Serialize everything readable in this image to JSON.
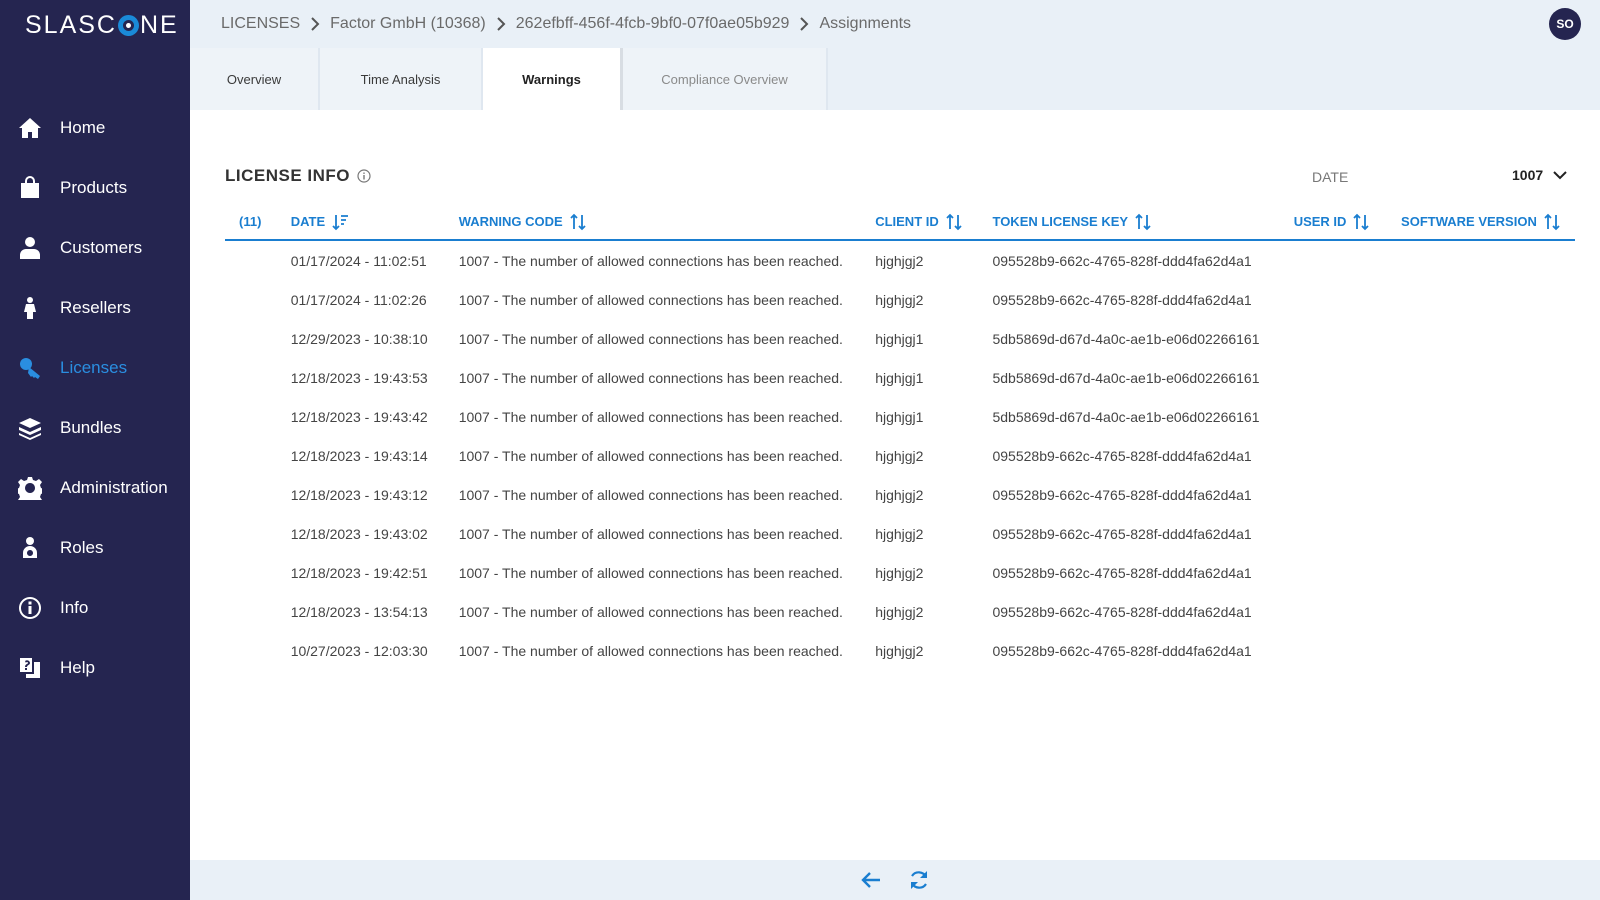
{
  "app": {
    "logo_text_left": "SLASC",
    "logo_text_right": "NE"
  },
  "colors": {
    "sidebar_bg": "#252550",
    "accent": "#1a7ed0",
    "topbar_bg": "#e9f0f7",
    "active_nav": "#2a8ee0"
  },
  "sidebar": {
    "items": [
      {
        "label": "Home",
        "icon": "home-icon"
      },
      {
        "label": "Products",
        "icon": "shopping-bag-icon"
      },
      {
        "label": "Customers",
        "icon": "user-icon"
      },
      {
        "label": "Resellers",
        "icon": "reseller-icon"
      },
      {
        "label": "Licenses",
        "icon": "key-icon",
        "active": true
      },
      {
        "label": "Bundles",
        "icon": "stack-icon"
      },
      {
        "label": "Administration",
        "icon": "gear-icon"
      },
      {
        "label": "Roles",
        "icon": "role-icon"
      },
      {
        "label": "Info",
        "icon": "info-icon"
      },
      {
        "label": "Help",
        "icon": "help-icon"
      }
    ]
  },
  "header": {
    "breadcrumb": [
      "LICENSES",
      "Factor GmbH (10368)",
      "262efbff-456f-4fcb-9bf0-07f0ae05b929",
      "Assignments"
    ],
    "avatar": "SO"
  },
  "tabs": [
    {
      "label": "Overview"
    },
    {
      "label": "Time Analysis"
    },
    {
      "label": "Warnings",
      "active": true
    },
    {
      "label": "Compliance Overview",
      "disabled": true
    }
  ],
  "main": {
    "section_title": "LICENSE INFO",
    "date_filter_label": "DATE",
    "date_filter_value": "1007"
  },
  "table": {
    "count": "(11)",
    "columns": [
      "DATE",
      "WARNING CODE",
      "CLIENT ID",
      "TOKEN LICENSE KEY",
      "USER ID",
      "SOFTWARE VERSION"
    ],
    "rows": [
      [
        "01/17/2024 - 11:02:51",
        "1007 - The number of allowed connections has been reached.",
        "hjghjgj2",
        "095528b9-662c-4765-828f-ddd4fa62d4a1",
        "",
        ""
      ],
      [
        "01/17/2024 - 11:02:26",
        "1007 - The number of allowed connections has been reached.",
        "hjghjgj2",
        "095528b9-662c-4765-828f-ddd4fa62d4a1",
        "",
        ""
      ],
      [
        "12/29/2023 - 10:38:10",
        "1007 - The number of allowed connections has been reached.",
        "hjghjgj1",
        "5db5869d-d67d-4a0c-ae1b-e06d02266161",
        "",
        ""
      ],
      [
        "12/18/2023 - 19:43:53",
        "1007 - The number of allowed connections has been reached.",
        "hjghjgj1",
        "5db5869d-d67d-4a0c-ae1b-e06d02266161",
        "",
        ""
      ],
      [
        "12/18/2023 - 19:43:42",
        "1007 - The number of allowed connections has been reached.",
        "hjghjgj1",
        "5db5869d-d67d-4a0c-ae1b-e06d02266161",
        "",
        ""
      ],
      [
        "12/18/2023 - 19:43:14",
        "1007 - The number of allowed connections has been reached.",
        "hjghjgj2",
        "095528b9-662c-4765-828f-ddd4fa62d4a1",
        "",
        ""
      ],
      [
        "12/18/2023 - 19:43:12",
        "1007 - The number of allowed connections has been reached.",
        "hjghjgj2",
        "095528b9-662c-4765-828f-ddd4fa62d4a1",
        "",
        ""
      ],
      [
        "12/18/2023 - 19:43:02",
        "1007 - The number of allowed connections has been reached.",
        "hjghjgj2",
        "095528b9-662c-4765-828f-ddd4fa62d4a1",
        "",
        ""
      ],
      [
        "12/18/2023 - 19:42:51",
        "1007 - The number of allowed connections has been reached.",
        "hjghjgj2",
        "095528b9-662c-4765-828f-ddd4fa62d4a1",
        "",
        ""
      ],
      [
        "12/18/2023 - 13:54:13",
        "1007 - The number of allowed connections has been reached.",
        "hjghjgj2",
        "095528b9-662c-4765-828f-ddd4fa62d4a1",
        "",
        ""
      ],
      [
        "10/27/2023 - 12:03:30",
        "1007 - The number of allowed connections has been reached.",
        "hjghjgj2",
        "095528b9-662c-4765-828f-ddd4fa62d4a1",
        "",
        ""
      ]
    ]
  },
  "footer": {
    "buttons": [
      "back-arrow-icon",
      "refresh-icon"
    ]
  }
}
